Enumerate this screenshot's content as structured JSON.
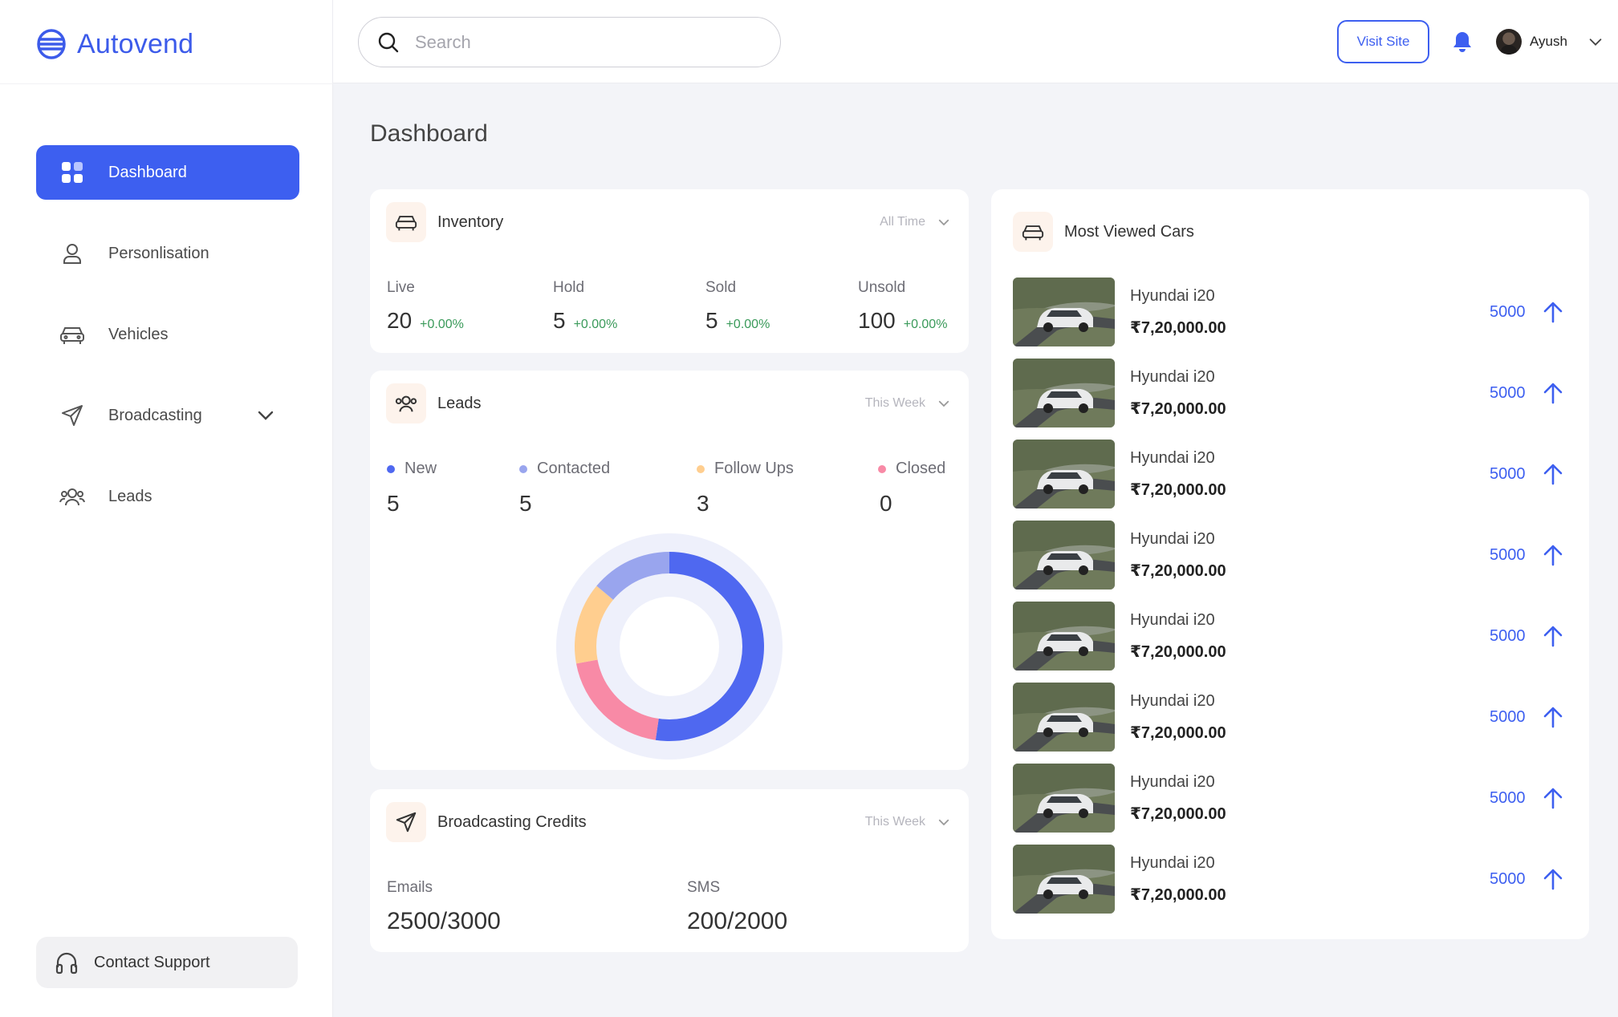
{
  "brand": {
    "name": "Autovend"
  },
  "search": {
    "placeholder": "Search"
  },
  "header": {
    "visit_label": "Visit Site",
    "user_name": "Ayush"
  },
  "sidebar": {
    "items": [
      {
        "label": "Dashboard",
        "icon": "grid-icon",
        "active": true
      },
      {
        "label": "Personlisation",
        "icon": "user-icon",
        "active": false
      },
      {
        "label": "Vehicles",
        "icon": "car-icon",
        "active": false
      },
      {
        "label": "Broadcasting",
        "icon": "send-icon",
        "active": false
      },
      {
        "label": "Leads",
        "icon": "people-icon",
        "active": false
      }
    ],
    "support_label": "Contact Support"
  },
  "page": {
    "title": "Dashboard"
  },
  "inventory": {
    "title": "Inventory",
    "filter": "All Time",
    "stats": [
      {
        "label": "Live",
        "value": "20",
        "change": "+0.00%"
      },
      {
        "label": "Hold",
        "value": "5",
        "change": "+0.00%"
      },
      {
        "label": "Sold",
        "value": "5",
        "change": "+0.00%"
      },
      {
        "label": "Unsold",
        "value": "100",
        "change": "+0.00%"
      }
    ]
  },
  "leads": {
    "title": "Leads",
    "filter": "This Week",
    "stats": [
      {
        "label": "New",
        "value": "5",
        "color": "#4f68f0"
      },
      {
        "label": "Contacted",
        "value": "5",
        "color": "#99a5ee"
      },
      {
        "label": "Follow Ups",
        "value": "3",
        "color": "#ffce8f"
      },
      {
        "label": "Closed",
        "value": "0",
        "color": "#f88aa6"
      }
    ]
  },
  "broadcasting": {
    "title": "Broadcasting Credits",
    "filter": "This Week",
    "emails_label": "Emails",
    "emails_value": "2500/3000",
    "sms_label": "SMS",
    "sms_value": "200/2000"
  },
  "most_viewed": {
    "title": "Most Viewed Cars",
    "cars": [
      {
        "name": "Hyundai i20",
        "price": "₹7,20,000.00",
        "views": "5000"
      },
      {
        "name": "Hyundai i20",
        "price": "₹7,20,000.00",
        "views": "5000"
      },
      {
        "name": "Hyundai i20",
        "price": "₹7,20,000.00",
        "views": "5000"
      },
      {
        "name": "Hyundai i20",
        "price": "₹7,20,000.00",
        "views": "5000"
      },
      {
        "name": "Hyundai i20",
        "price": "₹7,20,000.00",
        "views": "5000"
      },
      {
        "name": "Hyundai i20",
        "price": "₹7,20,000.00",
        "views": "5000"
      },
      {
        "name": "Hyundai i20",
        "price": "₹7,20,000.00",
        "views": "5000"
      },
      {
        "name": "Hyundai i20",
        "price": "₹7,20,000.00",
        "views": "5000"
      }
    ]
  },
  "chart_data": {
    "type": "pie",
    "categories": [
      "New",
      "Contacted",
      "Follow Ups",
      "Closed"
    ],
    "values": [
      45,
      12,
      12,
      17
    ],
    "colors": [
      "#4f68f0",
      "#99a5ee",
      "#ffce8f",
      "#f88aa6"
    ]
  },
  "colors": {
    "accent": "#3d5ff0",
    "positive": "#3a9a5a"
  }
}
